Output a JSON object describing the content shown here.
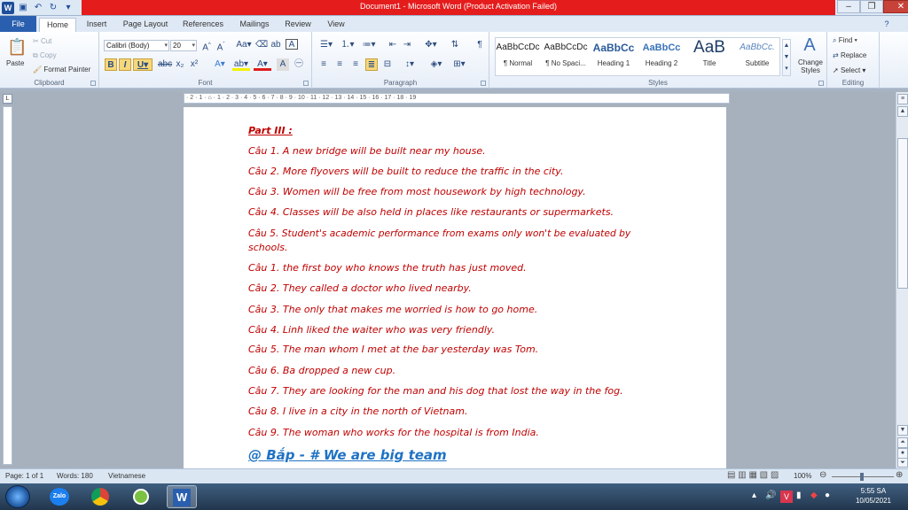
{
  "window": {
    "title": "Document1  -  Microsoft Word (Product Activation Failed)"
  },
  "quick_access": {
    "icons": [
      "word-logo",
      "save-icon",
      "undo-icon",
      "redo-icon",
      "customize-icon"
    ]
  },
  "tabs": [
    "File",
    "Home",
    "Insert",
    "Page Layout",
    "References",
    "Mailings",
    "Review",
    "View"
  ],
  "ribbon": {
    "clipboard": {
      "label": "Clipboard",
      "paste": "Paste",
      "cut": "Cut",
      "copy": "Copy",
      "format_painter": "Format Painter"
    },
    "font": {
      "label": "Font",
      "name": "Calibri (Body)",
      "size": "20"
    },
    "paragraph": {
      "label": "Paragraph"
    },
    "styles": {
      "label": "Styles",
      "items": [
        {
          "preview": "AaBbCcDc",
          "name": "¶ Normal"
        },
        {
          "preview": "AaBbCcDc",
          "name": "¶ No Spaci..."
        },
        {
          "preview": "AaBbCc",
          "name": "Heading 1"
        },
        {
          "preview": "AaBbCc",
          "name": "Heading 2"
        },
        {
          "preview": "AaB",
          "name": "Title"
        },
        {
          "preview": "AaBbCc.",
          "name": "Subtitle"
        }
      ],
      "change_styles": "Change Styles"
    },
    "editing": {
      "label": "Editing",
      "find": "Find",
      "replace": "Replace",
      "select": "Select"
    }
  },
  "ruler": {
    "marks": "· 2 · 1 · ⌂ · 1 · 2 · 3 · 4 · 5 · 6 · 7 · 8 · 9 · 10 · 11 · 12 · 13 · 14 · 15 · 16 · 17 · 18 · 19"
  },
  "document": {
    "heading": "Part III :",
    "lines": [
      "Câu 1. A new bridge will be built near my house.",
      "Câu 2. More flyovers will be built to reduce the traffic in the city.",
      "Câu 3. Women will be free from most housework by high technology.",
      "Câu 4. Classes will be also held in places like restaurants or supermarkets.",
      "Câu  5.  Student's  academic  performance  from  exams  only  won't  be  evaluated  by",
      "schools.",
      "Câu 1. the first boy who knows the truth has just moved.",
      "Câu 2. They called a doctor who lived nearby.",
      "Câu 3. The only that makes me worried is how to go home.",
      "Câu 4. Linh liked the waiter who was very friendly.",
      "Câu 5. The man whom I met at the bar yesterday was Tom.",
      "Câu 6. Ba dropped a new cup.",
      "Câu 7. They are looking for the man and his dog that lost the way in the fog.",
      "Câu 8. I live in a city in the north of Vietnam.",
      "Câu 9. The woman who works for the hospital is from India."
    ],
    "signature": "@ Bắp - # We are big team"
  },
  "status": {
    "page": "Page: 1 of 1",
    "words": "Words: 180",
    "language": "Vietnamese",
    "zoom": "100%"
  },
  "taskbar": {
    "apps": [
      "start-orb",
      "zalo",
      "chrome",
      "greenshot",
      "word"
    ],
    "zalo_label": "Zalo",
    "time": "5:55 SA",
    "date": "10/05/2021"
  }
}
